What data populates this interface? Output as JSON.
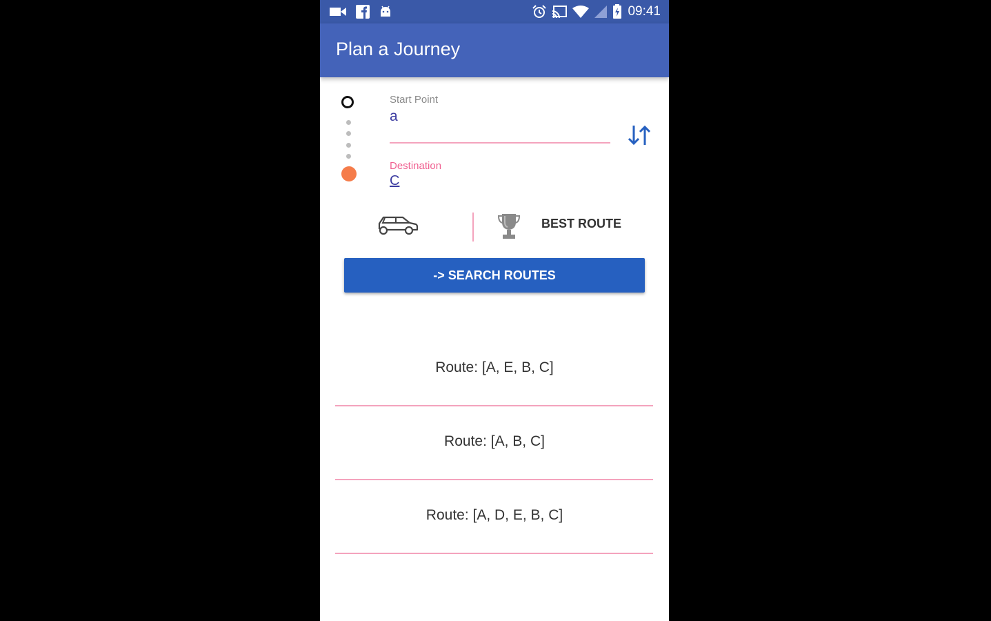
{
  "status_bar": {
    "time": "09:41",
    "left_icons": [
      "video-camera-icon",
      "facebook-icon",
      "android-icon"
    ],
    "right_icons": [
      "alarm-icon",
      "cast-icon",
      "wifi-icon",
      "signal-icon",
      "battery-charging-icon"
    ]
  },
  "app_bar": {
    "title": "Plan a Journey"
  },
  "form": {
    "start": {
      "label": "Start Point",
      "value": "a"
    },
    "destination": {
      "label": "Destination",
      "value": "C"
    },
    "swap_icon": "swap-vertical-icon"
  },
  "mode": {
    "vehicle_icon": "car-icon",
    "preference_icon": "trophy-icon",
    "preference_label": "BEST ROUTE"
  },
  "search_button": {
    "label": "-> SEARCH ROUTES"
  },
  "routes": [
    {
      "text": "Route: [A, E, B, C]"
    },
    {
      "text": "Route: [A, B, C]"
    },
    {
      "text": "Route: [A, D, E, B, C]"
    }
  ],
  "colors": {
    "app_bar": "#4463b9",
    "status_bar": "#3a59a8",
    "button": "#2660c0",
    "accent_pink": "#f06292",
    "destination_dot": "#f57c4a"
  }
}
